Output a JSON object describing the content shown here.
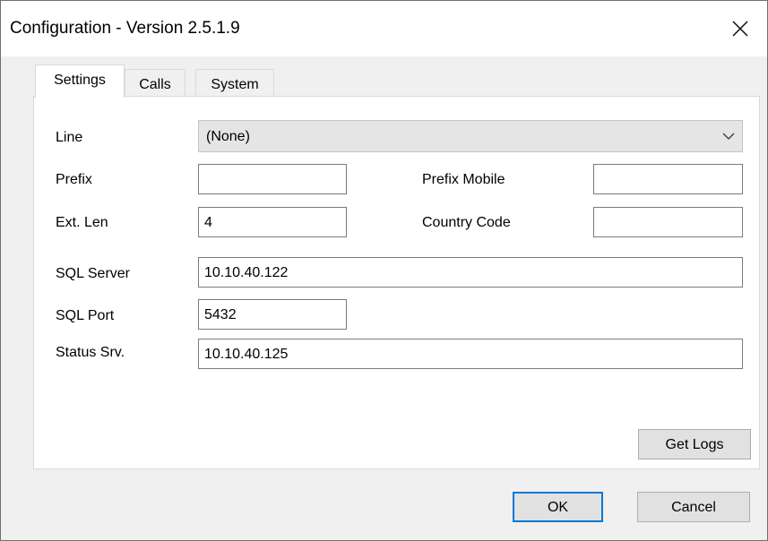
{
  "window": {
    "title": "Configuration - Version 2.5.1.9"
  },
  "tabs": [
    {
      "label": "Settings"
    },
    {
      "label": "Calls"
    },
    {
      "label": "System"
    }
  ],
  "settings": {
    "line": {
      "label": "Line",
      "value": "(None)"
    },
    "prefix": {
      "label": "Prefix",
      "value": ""
    },
    "prefix_mobile": {
      "label": "Prefix Mobile",
      "value": ""
    },
    "ext_len": {
      "label": "Ext. Len",
      "value": "4"
    },
    "country_code": {
      "label": "Country Code",
      "value": ""
    },
    "sql_server": {
      "label": "SQL Server",
      "value": "10.10.40.122"
    },
    "sql_port": {
      "label": "SQL Port",
      "value": "5432"
    },
    "status_srv": {
      "label": "Status Srv.",
      "value": "10.10.40.125"
    },
    "get_logs_label": "Get Logs"
  },
  "footer": {
    "ok_label": "OK",
    "cancel_label": "Cancel"
  },
  "icons": {
    "close": "close-icon",
    "dropdown": "chevron-down-icon"
  },
  "colors": {
    "accent": "#0078d7",
    "window_bg": "#f0f0f0"
  }
}
